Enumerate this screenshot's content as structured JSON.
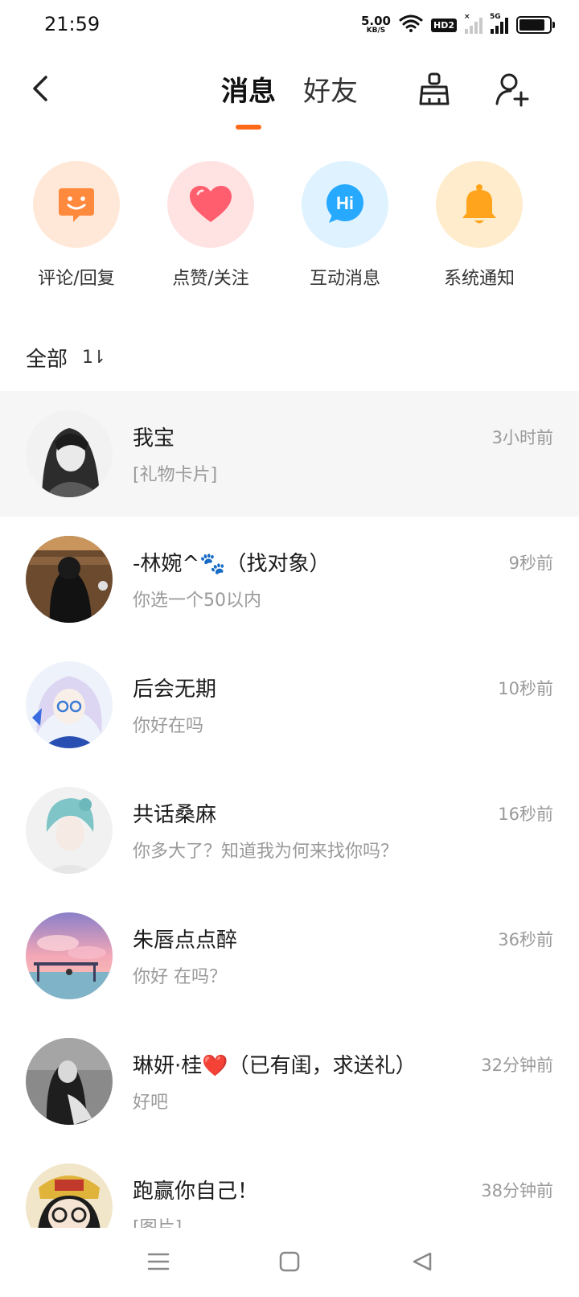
{
  "status_bar": {
    "time": "21:59",
    "net_speed_value": "5.00",
    "net_speed_unit": "KB/S",
    "hd_badge": "HD2",
    "sim1_tag": "×",
    "sim2_tag": "5G",
    "battery_level": 0.85
  },
  "header": {
    "tabs": [
      {
        "label": "消息",
        "active": true
      },
      {
        "label": "好友",
        "active": false
      }
    ],
    "accent_color": "#ff6a1a"
  },
  "quick_entries": [
    {
      "label": "评论/回复",
      "icon": "comment-smile-icon",
      "bg": "#ffe8d8",
      "color": "#ff8a3d"
    },
    {
      "label": "点赞/关注",
      "icon": "heart-icon",
      "bg": "#ffe3e3",
      "color": "#ff5e6e"
    },
    {
      "label": "互动消息",
      "icon": "hi-chat-icon",
      "bg": "#dff2ff",
      "color": "#27a9ff"
    },
    {
      "label": "系统通知",
      "icon": "bell-icon",
      "bg": "#ffeccc",
      "color": "#ffa41c"
    }
  ],
  "filter": {
    "label": "全部",
    "sort_icon": "1⇂"
  },
  "conversations": [
    {
      "name": "我宝",
      "preview": "[礼物卡片]",
      "time": "3小时前",
      "avatar_style": "dark-girl"
    },
    {
      "name": "-林婉^🐾（找对象）",
      "preview": "你选一个50以内",
      "time": "9秒前",
      "avatar_style": "warm-dark"
    },
    {
      "name": "后会无期",
      "preview": "你好在吗",
      "time": "10秒前",
      "avatar_style": "anime-blue"
    },
    {
      "name": "共话桑麻",
      "preview": "你多大了？知道我为何来找你吗？",
      "time": "16秒前",
      "avatar_style": "anime-teal"
    },
    {
      "name": "朱唇点点醉",
      "preview": "你好  在吗？",
      "time": "36秒前",
      "avatar_style": "pink-sky"
    },
    {
      "name": "琳妍·桂❤️（已有闺，求送礼）",
      "preview": "好吧",
      "time": "32分钟前",
      "avatar_style": "bw-girl"
    },
    {
      "name": "跑赢你自己！",
      "preview": "[图片]",
      "time": "38分钟前",
      "avatar_style": "cartoon"
    }
  ]
}
